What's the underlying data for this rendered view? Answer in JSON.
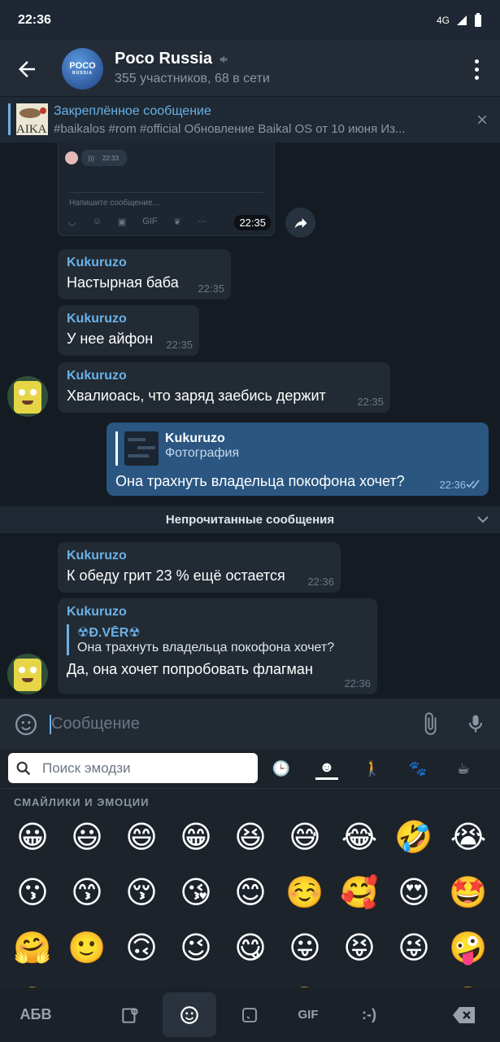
{
  "status": {
    "time": "22:36",
    "network": "4G"
  },
  "header": {
    "back_icon": "arrow-left-icon",
    "avatar_text": "POCO",
    "avatar_sub": "RUSSIA",
    "title": "Poco Russia",
    "muted_icon": "mute-icon",
    "subtitle": "355 участников, 68 в сети"
  },
  "pinned": {
    "label": "Закреплённое сообщение",
    "thumb_text": "AIKA",
    "text": "#baikalos #rom #official  Обновление Baikal OS от 10 июня  Из..."
  },
  "shot": {
    "placeholder": "Напишите сообщение...",
    "voice_time": "22:33",
    "time": "22:35"
  },
  "messages": [
    {
      "name": "Kukuruzo",
      "text": "Настырная баба",
      "time": "22:35"
    },
    {
      "name": "Kukuruzo",
      "text": "У нее айфон",
      "time": "22:35"
    },
    {
      "name": "Kukuruzo",
      "text": "Хвалиоась, что заряд заебись держит",
      "time": "22:35"
    },
    {
      "reply_name": "Kukuruzo",
      "reply_text": "Фотография",
      "text": "Она трахнуть владельца покофона хочет?",
      "time": "22:36"
    },
    {
      "name": "Kukuruzo",
      "text": "К обеду грит 23 % ещё остается",
      "time": "22:36"
    },
    {
      "name": "Kukuruzo",
      "quote_name": "☢Đ.VĒR☢",
      "quote_text": "Она трахнуть владельца покофона хочет?",
      "text": "Да, она хочет попробовать флагман",
      "time": "22:36"
    }
  ],
  "unread_label": "Непрочитанные сообщения",
  "input": {
    "placeholder": "Сообщение"
  },
  "emoji_panel": {
    "search_placeholder": "Поиск эмодзи",
    "section": "СМАЙЛИКИ И ЭМОЦИИ",
    "tabs": [
      "clock-icon",
      "smile-icon",
      "person-icon",
      "animal-icon",
      "food-icon"
    ],
    "emojis": [
      "😀",
      "😃",
      "😄",
      "😁",
      "😆",
      "😅",
      "😂",
      "🤣",
      "😭",
      "😗",
      "😙",
      "😚",
      "😘",
      "😊",
      "☺️",
      "🥰",
      "😍",
      "🤩",
      "🤗",
      "🙂",
      "🙃",
      "😉",
      "😋",
      "😛",
      "😝",
      "😜",
      "🤪",
      "🤔",
      "😏",
      "😐",
      "😑",
      "😶",
      "😬",
      "😒",
      "😌",
      "🤨"
    ]
  },
  "navbar": {
    "abc": "АБВ",
    "gif": "GIF",
    "emoticon": ":-)"
  },
  "colors": {
    "accent": "#6bb1e8",
    "outgoing": "#2a5681",
    "incoming": "#222a33"
  }
}
